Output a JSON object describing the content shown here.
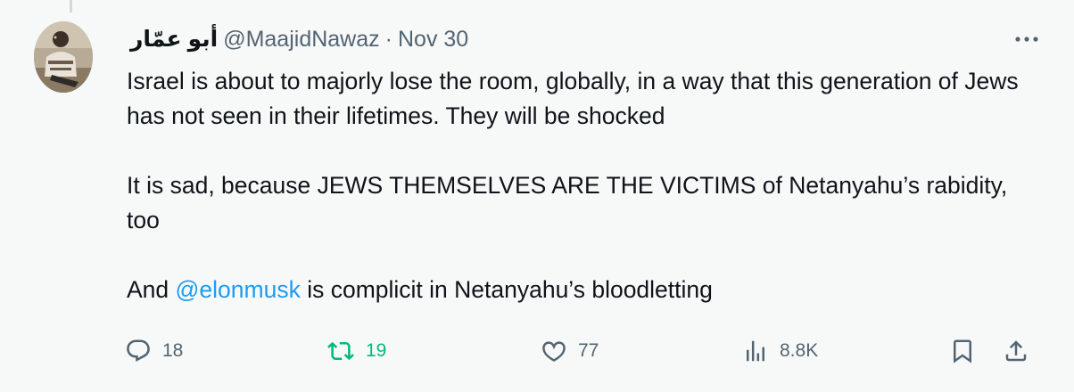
{
  "tweet": {
    "display_name": "أبو عمّار",
    "handle": "@MaajidNawaz",
    "separator": "·",
    "date": "Nov 30",
    "more_label": "More",
    "body": {
      "line1": "Israel is about to majorly lose the room, globally, in a way that this generation of Jews has not seen in their lifetimes. They will be shocked",
      "line2": "It is sad, because JEWS THEMSELVES ARE THE VICTIMS of Netanyahu’s rabidity, too",
      "line3_prefix": "And ",
      "mention": "@elonmusk",
      "line3_suffix": " is complicit in Netanyahu’s bloodletting"
    },
    "actions": {
      "replies": "18",
      "retweets": "19",
      "likes": "77",
      "views": "8.8K"
    },
    "colors": {
      "accent": "#1d9bf0",
      "retweet_active": "#00ba7c",
      "secondary_text": "#536471"
    },
    "icons": {
      "reply": "reply-icon",
      "retweet": "retweet-icon",
      "like": "heart-icon",
      "views": "analytics-icon",
      "bookmark": "bookmark-icon",
      "share": "share-icon",
      "more": "more-icon"
    }
  }
}
